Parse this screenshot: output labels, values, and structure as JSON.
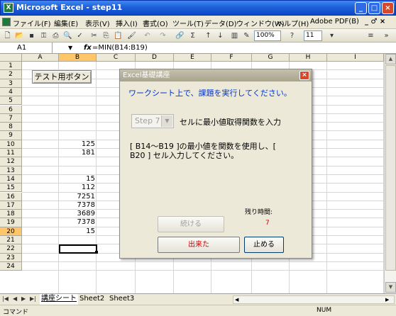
{
  "window": {
    "title": "Microsoft Excel - step11",
    "app_icon_glyph": "X",
    "minimize": "_",
    "maximize": "□",
    "close": "×"
  },
  "menubar": {
    "items": [
      "ファイル(F)",
      "編集(E)",
      "表示(V)",
      "挿入(I)",
      "書式(O)",
      "ツール(T)",
      "データ(D)",
      "ウィンドウ(W)",
      "ヘルプ(H)",
      "Adobe PDF(B)"
    ],
    "doc_controls": "_ ♂ ×"
  },
  "toolbar": {
    "zoom": "100%",
    "font_size": "11",
    "help_glyph": "?"
  },
  "formula_bar": {
    "name_box": "A1",
    "fx": "fx",
    "formula": "=MIN(B14:B19)"
  },
  "grid": {
    "columns": [
      "A",
      "B",
      "C",
      "D",
      "E",
      "F",
      "G",
      "H",
      "I"
    ],
    "rows": [
      "1",
      "2",
      "3",
      "4",
      "5",
      "6",
      "7",
      "8",
      "9",
      "10",
      "11",
      "12",
      "13",
      "14",
      "15",
      "16",
      "17",
      "18",
      "19",
      "20",
      "21",
      "22",
      "23",
      "24"
    ],
    "cells": [
      {
        "row": "10",
        "value": "125"
      },
      {
        "row": "11",
        "value": "181"
      },
      {
        "row": "14",
        "value": "15"
      },
      {
        "row": "15",
        "value": "112"
      },
      {
        "row": "16",
        "value": "7251"
      },
      {
        "row": "17",
        "value": "7378"
      },
      {
        "row": "18",
        "value": "3689"
      },
      {
        "row": "19",
        "value": "7378"
      },
      {
        "row": "20",
        "value": "15"
      }
    ],
    "selected_column": "B",
    "selected_row": "20"
  },
  "sheet_button": "テスト用ボタン",
  "sheet_tabs": [
    "講座シート",
    "Sheet2",
    "Sheet3"
  ],
  "status": {
    "mode": "コマンド",
    "num": "NUM"
  },
  "dialog": {
    "title": "Excel基礎講座",
    "instruction": "ワークシート上で、課題を実行してください。",
    "step": "Step 7",
    "step_task": "セルに最小値取得関数を入力",
    "desc_line1": "[ B14～B19 ]の最小値を関数を使用し、[",
    "desc_line2": "B20 ] セル入力してください。",
    "remaining_label": "残り時間:",
    "remaining_value": "7",
    "continue_label": "続ける",
    "done_label": "出来た",
    "stop_label": "止める"
  },
  "colors": {
    "accent_blue": "#0033cc",
    "alert_red": "#cc0000",
    "selection": "#ffc669"
  }
}
